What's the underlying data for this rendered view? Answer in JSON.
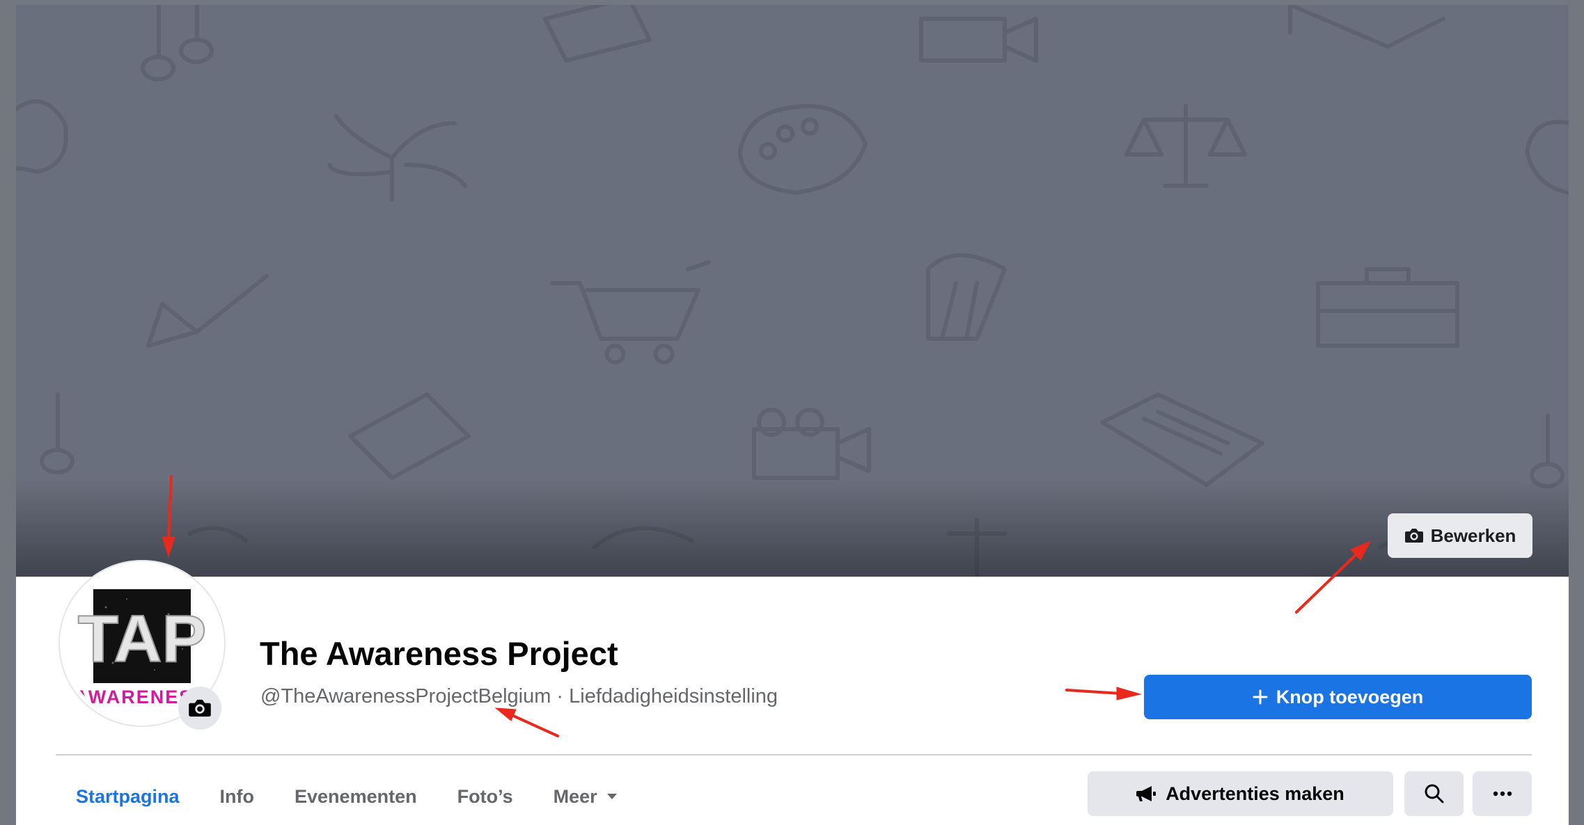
{
  "cover": {
    "edit_label": "Bewerken",
    "background_color": "#6a6f7d"
  },
  "profile": {
    "logo_text_top": "TAP",
    "logo_text_bottom": "AWARENES",
    "camera_icon": "camera-icon"
  },
  "header": {
    "title": "The Awareness Project",
    "handle": "@TheAwarenessProjectBelgium",
    "separator": " · ",
    "category": "Liefdadigheidsinstelling"
  },
  "actions": {
    "add_button_label": "Knop toevoegen",
    "add_button_color": "#1b74e4",
    "ads_button_label": "Advertenties maken",
    "search_icon": "search-icon",
    "more_icon": "more-icon"
  },
  "tabs": [
    {
      "label": "Startpagina",
      "active": true
    },
    {
      "label": "Info",
      "active": false
    },
    {
      "label": "Evenementen",
      "active": false
    },
    {
      "label": "Foto’s",
      "active": false
    },
    {
      "label": "Meer",
      "active": false
    }
  ],
  "annotation_color": "#e8291c"
}
